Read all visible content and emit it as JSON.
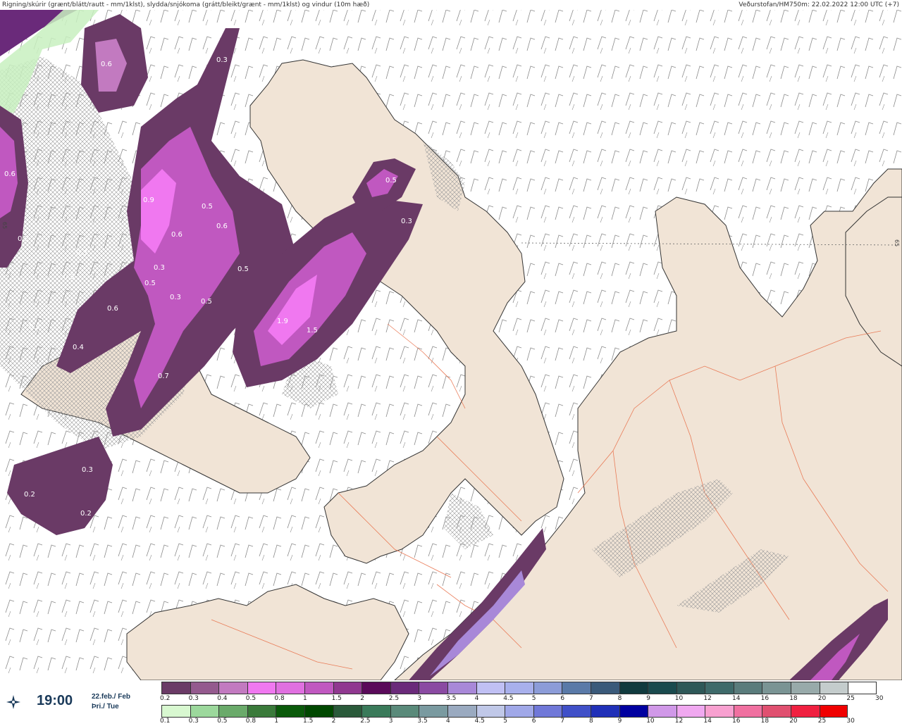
{
  "header": {
    "left_title": "Rigning/skúrir (grænt/blátt/rautt - mm/1klst), slydda/snjókoma (grátt/bleikt/grænt - mm/1klst) og vindur (10m hæð)",
    "right_title": "Veðurstofan/HM750m: 22.02.2022 12:00 UTC (+7)"
  },
  "time_panel": {
    "time": "19:00",
    "date_line1": "22.feb./ Feb",
    "date_line2": "Þri./ Tue",
    "compass_icon": "compass-rose-icon"
  },
  "map": {
    "axis_label_left": "65",
    "axis_label_right": "65",
    "colors": {
      "land": "#f1e4d6",
      "sea": "#ffffff",
      "coast": "#333333",
      "roads": "#e8704a"
    },
    "contour_labels": [
      {
        "text": "0.6"
      },
      {
        "text": "0.3"
      },
      {
        "text": "0.6"
      },
      {
        "text": "0.9"
      },
      {
        "text": "0.5"
      },
      {
        "text": "0.6"
      },
      {
        "text": "0.6"
      },
      {
        "text": "0.3"
      },
      {
        "text": "0.5"
      },
      {
        "text": "0.3"
      },
      {
        "text": "0.5"
      },
      {
        "text": "0.2"
      },
      {
        "text": "0.3"
      },
      {
        "text": "0.3"
      },
      {
        "text": "0.6"
      },
      {
        "text": "0.5"
      },
      {
        "text": "0.3"
      },
      {
        "text": "0.5"
      },
      {
        "text": "0.3"
      },
      {
        "text": "1.9"
      },
      {
        "text": "1.5"
      },
      {
        "text": "0.4"
      },
      {
        "text": "0.7"
      },
      {
        "text": "0.3"
      },
      {
        "text": "0.2"
      },
      {
        "text": "0.2"
      }
    ]
  },
  "legend": {
    "row1": {
      "colors": [
        "#6a3a66",
        "#945a8e",
        "#c27ac0",
        "#f078f0",
        "#e070e0",
        "#c058c0",
        "#903890",
        "#5a0a5a",
        "#6a2a7a",
        "#8a4aa2",
        "#a888d8",
        "#c0c0f4",
        "#a8b0ec",
        "#8c9cd8",
        "#5a7aa8",
        "#3a5a7a",
        "#103a3e",
        "#1a4a4e",
        "#2e5858",
        "#3e6a6a",
        "#5a7c7c",
        "#7a9494",
        "#98aaaa",
        "#c4cccc",
        "#ffffff"
      ],
      "labels": [
        "0.2",
        "0.3",
        "0.4",
        "0.5",
        "0.8",
        "1",
        "1.5",
        "2",
        "2.5",
        "3",
        "3.5",
        "4",
        "4.5",
        "5",
        "6",
        "7",
        "8",
        "9",
        "10",
        "12",
        "14",
        "16",
        "18",
        "20",
        "25",
        "30"
      ]
    },
    "row2": {
      "colors": [
        "#d8f8d0",
        "#9cd89c",
        "#6aaa6a",
        "#3a7a3a",
        "#0a5a0a",
        "#004800",
        "#2a5a3a",
        "#3a7a5a",
        "#5a8a7a",
        "#7a9aa0",
        "#9aaac0",
        "#c0c8e8",
        "#a0a8e8",
        "#7078d8",
        "#4050c8",
        "#2030b8",
        "#0000a0",
        "#d098e8",
        "#f0a8f0",
        "#f8a0d0",
        "#f070a0",
        "#e05070",
        "#f02040",
        "#f00000"
      ],
      "labels": [
        "0.1",
        "0.3",
        "0.5",
        "0.8",
        "1",
        "1.5",
        "2",
        "2.5",
        "3",
        "3.5",
        "4",
        "4.5",
        "5",
        "6",
        "7",
        "8",
        "9",
        "10",
        "12",
        "14",
        "16",
        "18",
        "20",
        "25",
        "30"
      ]
    }
  }
}
